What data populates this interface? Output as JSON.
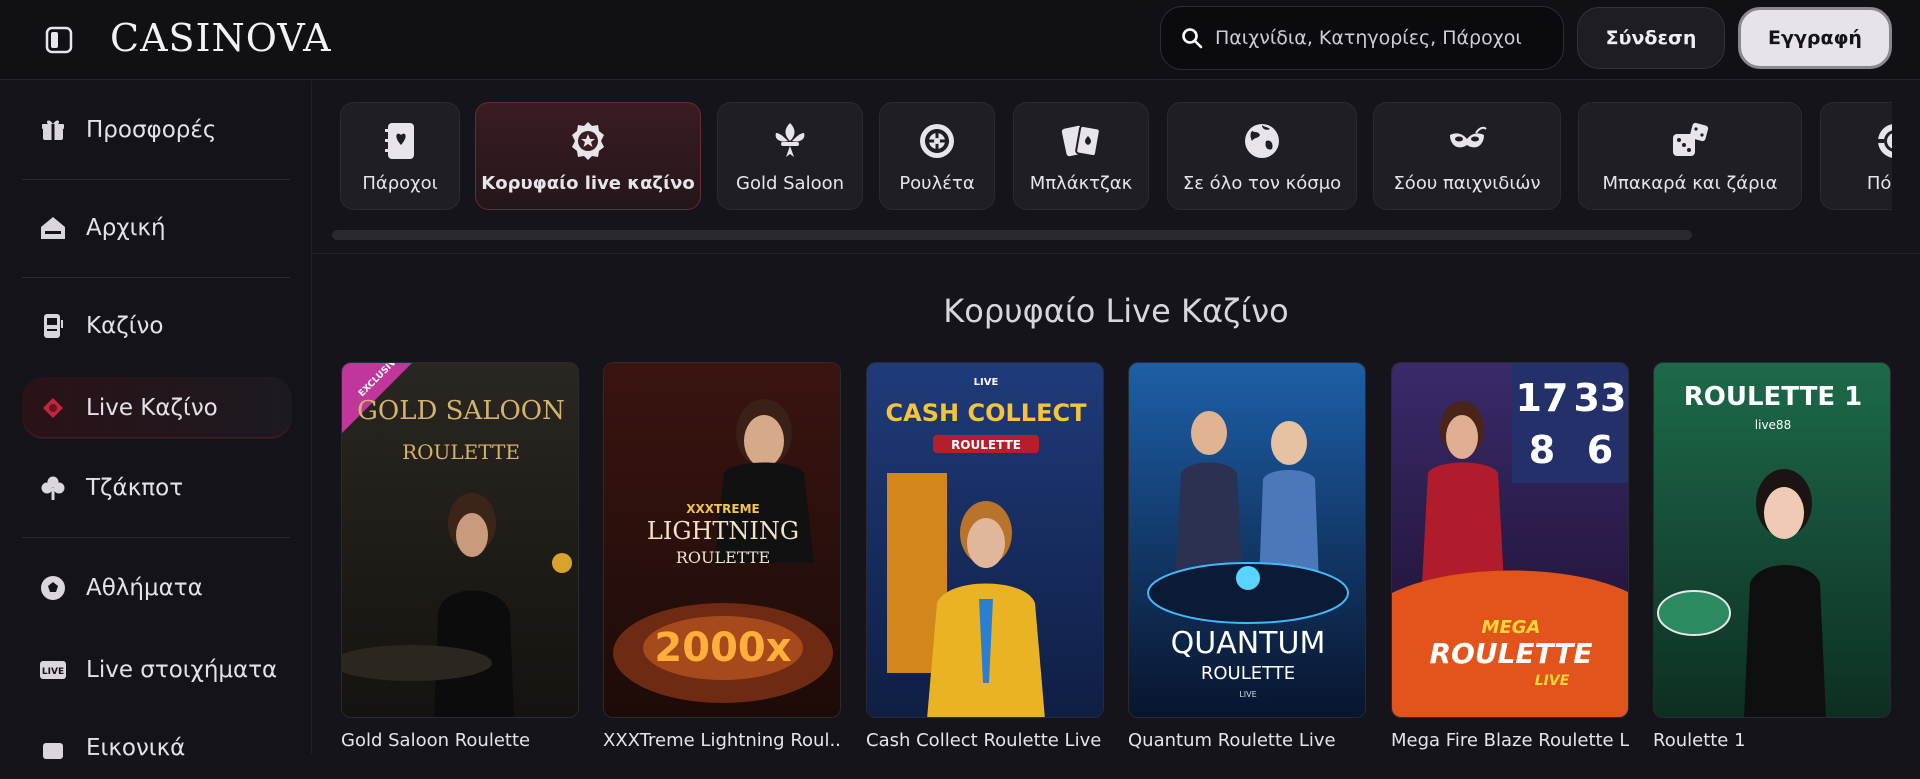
{
  "header": {
    "logo": "CASINOVA",
    "search_placeholder": "Παιχνίδια, Κατηγορίες, Πάροχοι",
    "login_label": "Σύνδεση",
    "register_label": "Εγγραφή"
  },
  "sidebar": {
    "items": [
      {
        "label": "Προσφορές",
        "icon": "gift-icon"
      },
      {
        "label": "Αρχική",
        "icon": "home-icon"
      },
      {
        "label": "Καζίνο",
        "icon": "slot-machine-icon"
      },
      {
        "label": "Live Καζίνο",
        "icon": "live-casino-icon",
        "active": true
      },
      {
        "label": "Τζάκποτ",
        "icon": "clover-icon"
      },
      {
        "label": "Αθλήματα",
        "icon": "soccer-ball-icon"
      },
      {
        "label": "Live στοιχήματα",
        "icon": "live-badge-icon"
      },
      {
        "label": "Εικονικά",
        "icon": "virtual-icon"
      }
    ]
  },
  "categories": [
    {
      "label": "Πάροχοι",
      "icon": "providers-icon"
    },
    {
      "label": "Κορυφαίο live καζίνο",
      "icon": "top-star-badge-icon",
      "active": true
    },
    {
      "label": "Gold Saloon",
      "icon": "fleur-de-lis-icon"
    },
    {
      "label": "Ρουλέτα",
      "icon": "roulette-icon"
    },
    {
      "label": "Μπλάκτζακ",
      "icon": "cards-icon"
    },
    {
      "label": "Σε όλο τον κόσμο",
      "icon": "globe-icon"
    },
    {
      "label": "Σόου παιχνιδιών",
      "icon": "mask-icon"
    },
    {
      "label": "Μπακαρά και ζάρια",
      "icon": "dice-icon"
    },
    {
      "label": "Πόκερ",
      "icon": "poker-chip-icon"
    }
  ],
  "section": {
    "title": "Κορυφαίο Live Καζίνο"
  },
  "games": [
    {
      "name": "Gold Saloon Roulette",
      "art_title": "GOLD SALOON",
      "art_sub": "ROULETTE",
      "art_tag": "EXCLUSIVE"
    },
    {
      "name": "XXXTreme Lightning Roul...",
      "art_title": "LIGHTNING",
      "art_sub": "ROULETTE",
      "art_tag": "XXXTREME",
      "art_mult": "2000x"
    },
    {
      "name": "Cash Collect Roulette Live",
      "art_title": "CASH COLLECT",
      "art_sub": "ROULETTE",
      "art_tag": "LIVE"
    },
    {
      "name": "Quantum Roulette Live",
      "art_title": "QUANTUM",
      "art_sub": "ROULETTE",
      "art_tag": "LIVE"
    },
    {
      "name": "Mega Fire Blaze Roulette L...",
      "art_title": "ROULETTE",
      "art_sub": "LIVE",
      "art_tag": "MEGA",
      "art_nums": [
        "17",
        "33",
        "8",
        "6"
      ]
    },
    {
      "name": "Roulette 1",
      "art_title": "ROULETTE 1",
      "art_sub": "live88"
    }
  ],
  "colors": {
    "background": "#15141a",
    "accent_active": "#6a2b33",
    "register_bg": "#e6e4ea"
  }
}
